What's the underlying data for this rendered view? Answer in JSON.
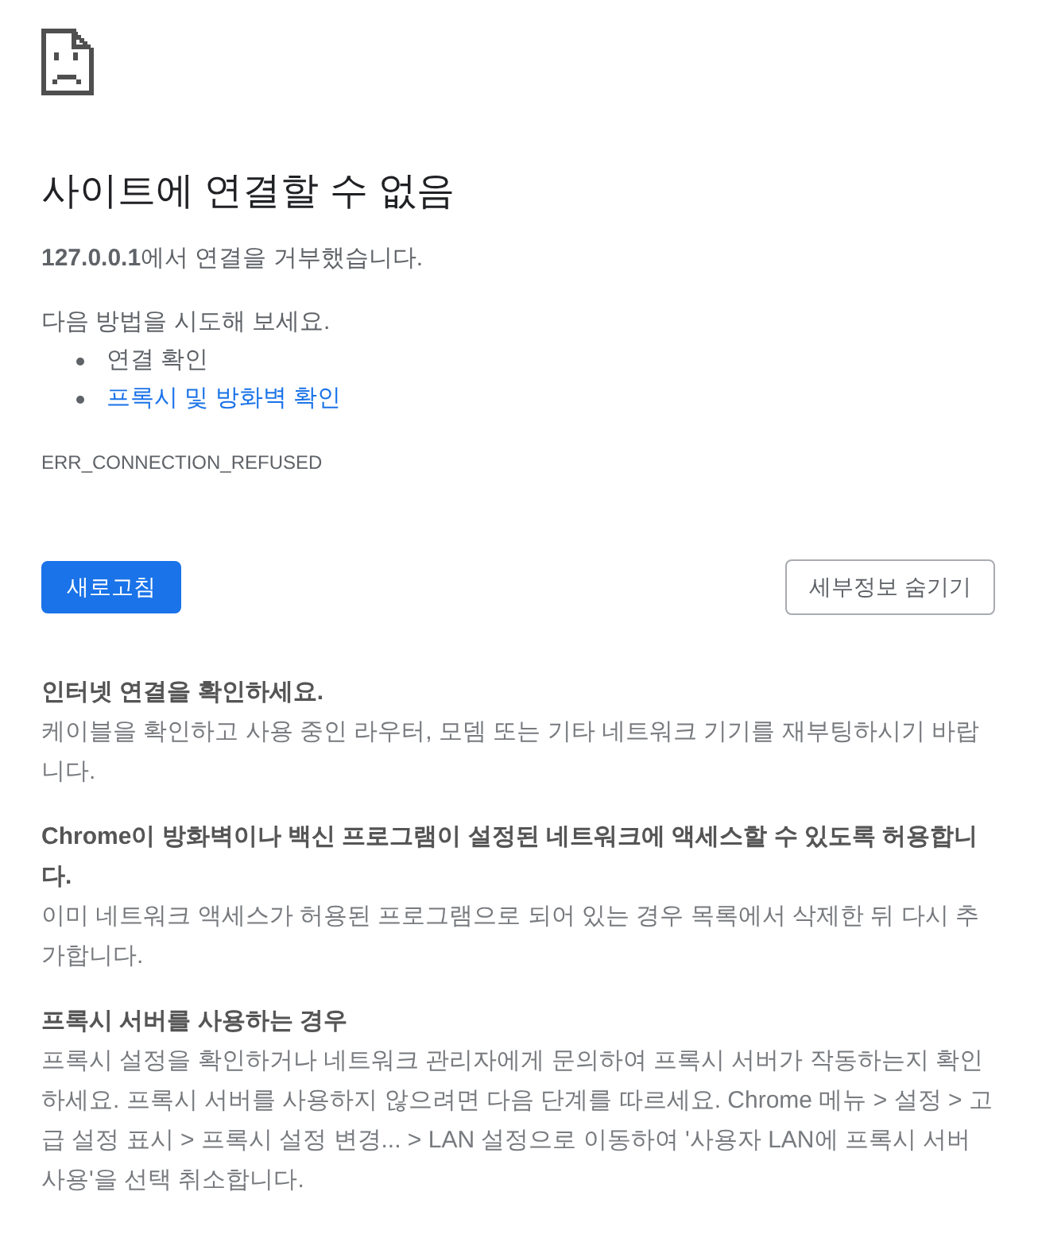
{
  "title": "사이트에 연결할 수 없음",
  "summary": "**127.0.0.1**에서 연결을 거부했습니다.",
  "suggestions": {
    "heading": "다음 방법을 시도해 보세요.",
    "items": [
      {
        "kind": "text",
        "text": "연결 확인"
      },
      {
        "kind": "link",
        "text": "프록시 및 방화벽 확인"
      }
    ]
  },
  "error_code": "ERR_CONNECTION_REFUSED",
  "buttons": [
    {
      "kind": "primary",
      "label": "새로고침"
    },
    {
      "kind": "secondary",
      "label": "세부정보 숨기기"
    }
  ],
  "details": [
    {
      "heading": "인터넷 연결을 확인하세요.",
      "text": "케이블을 확인하고 사용 중인 라우터, 모뎀 또는 기타 네트워크 기기를 재부팅하시기 바랍니다."
    },
    {
      "heading": "Chrome이 방화벽이나 백신 프로그램이 설정된 네트워크에 액세스할 수 있도록 허용합니다.",
      "text": "이미 네트워크 액세스가 허용된 프로그램으로 되어 있는 경우 목록에서 삭제한 뒤 다시 추가합니다."
    },
    {
      "heading": "프록시 서버를 사용하는 경우",
      "text": "프록시 설정을 확인하거나 네트워크 관리자에게 문의하여 프록시 서버가 작동하는지 확인하세요. 프록시 서버를 사용하지 않으려면 다음 단계를 따르세요. Chrome 메뉴 > 설정 > 고급 설정 표시 > 프록시 설정 변경... > LAN 설정으로 이동하여 '사용자 LAN에 프록시 서버 사용'을 선택 취소합니다."
    }
  ]
}
